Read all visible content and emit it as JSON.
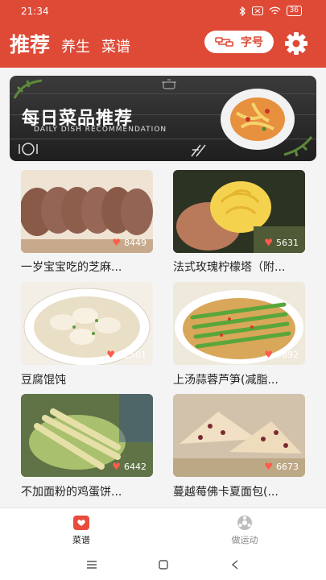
{
  "status": {
    "time": "21:34",
    "battery": "36"
  },
  "header": {
    "tabs": [
      "推荐",
      "养生",
      "菜谱"
    ],
    "font_button": "字号"
  },
  "banner": {
    "title": "每日菜品推荐",
    "subtitle": "DAILY DISH RECOMMENDATION"
  },
  "recipes": [
    {
      "title": "一岁宝宝吃的芝麻...",
      "likes": "8449"
    },
    {
      "title": "法式玫瑰柠檬塔（附...",
      "likes": "5631"
    },
    {
      "title": "豆腐馄饨",
      "likes": "12501"
    },
    {
      "title": "上汤蒜蓉芦笋(减脂...",
      "likes": "9892"
    },
    {
      "title": "不加面粉的鸡蛋饼...",
      "likes": "6442"
    },
    {
      "title": "蔓越莓佛卡夏面包(...",
      "likes": "6673"
    }
  ],
  "bottom_nav": [
    {
      "label": "菜谱"
    },
    {
      "label": "做运动"
    }
  ],
  "colors": {
    "accent": "#df4a36"
  },
  "icons": [
    "settings-icon",
    "font-size-icon",
    "heart-icon",
    "recipe-icon",
    "exercise-icon"
  ]
}
